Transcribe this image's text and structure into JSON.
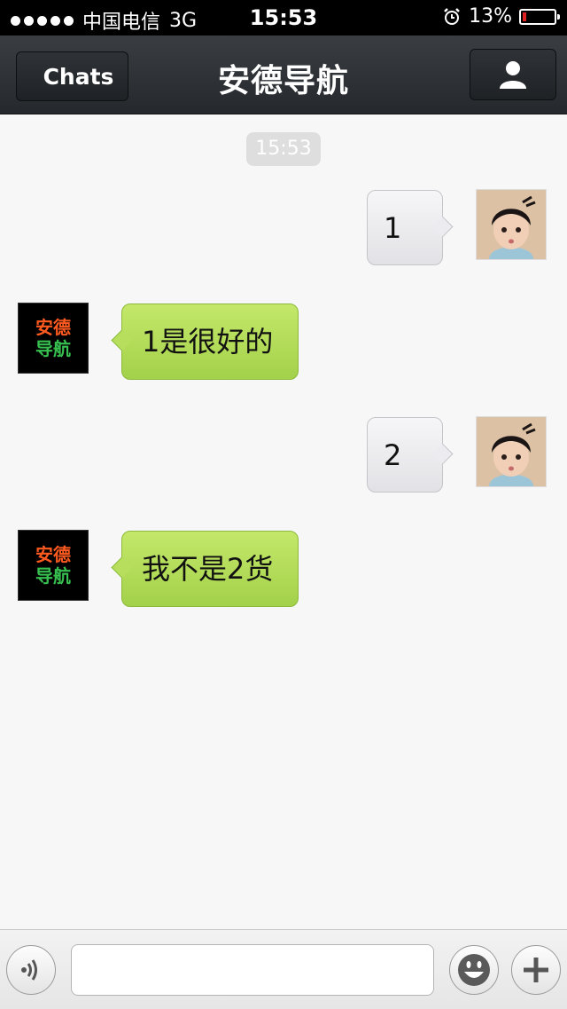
{
  "status_bar": {
    "carrier": "中国电信",
    "network": "3G",
    "time": "15:53",
    "battery_text": "13%",
    "battery_level": 0.13,
    "signal_dots": 5
  },
  "nav": {
    "back_label": "Chats",
    "title": "安德导航"
  },
  "chat": {
    "timestamp": "15:53",
    "messages": [
      {
        "direction": "outgoing",
        "text": "1"
      },
      {
        "direction": "incoming",
        "text": "1是很好的"
      },
      {
        "direction": "outgoing",
        "text": "2"
      },
      {
        "direction": "incoming",
        "text": "我不是2货"
      }
    ],
    "contact_avatar_text": "安德导航"
  },
  "input_bar": {
    "value": "",
    "icons": [
      "voice-icon",
      "emoji-icon",
      "plus-icon"
    ]
  },
  "colors": {
    "incoming_bubble": "#b2dc58",
    "outgoing_bubble": "#ececf0",
    "nav_bar": "#2e3236",
    "battery_low": "#e02020",
    "logo_orange": "#ff5a1f",
    "logo_green": "#37c04f"
  }
}
